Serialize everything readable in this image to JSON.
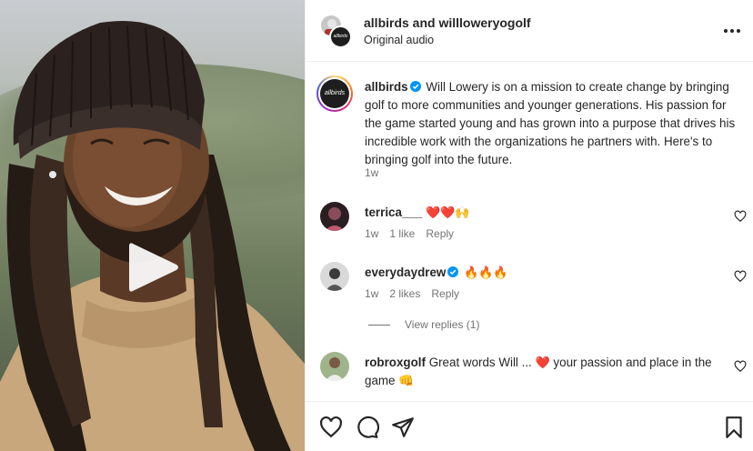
{
  "post": {
    "header": {
      "names": "allbirds and willloweryogolf",
      "audio": "Original audio",
      "account_logo": "allbirds"
    },
    "caption": {
      "username": "allbirds",
      "text": "Will Lowery is on a mission to create change by bringing golf to more communities and younger generations. His passion for the game started young and has grown into a purpose that drives his incredible work with the organizations he partners with. Here's to bringing golf into the future.",
      "time": "1w",
      "logo": "allbirds"
    },
    "comments": [
      {
        "username": "terrica___",
        "text": "❤️❤️🙌",
        "time": "1w",
        "likes": "1 like",
        "reply": "Reply"
      },
      {
        "username": "everydaydrew",
        "text": "🔥🔥🔥",
        "time": "1w",
        "likes": "2 likes",
        "reply": "Reply",
        "verified": true
      },
      {
        "username": "robroxgolf",
        "text_before": "Great words Will ... ",
        "text_after": " your passion and place in the game 👊",
        "heart": "❤️"
      }
    ],
    "view_replies": "View replies (1)"
  },
  "colors": {
    "text": "#262626",
    "muted": "#737373",
    "verified": "#0095f6",
    "heart": "#ed4956"
  },
  "icons": [
    "more-icon",
    "play-icon",
    "heart-icon",
    "comment-icon",
    "share-icon",
    "bookmark-icon",
    "verified-icon"
  ]
}
